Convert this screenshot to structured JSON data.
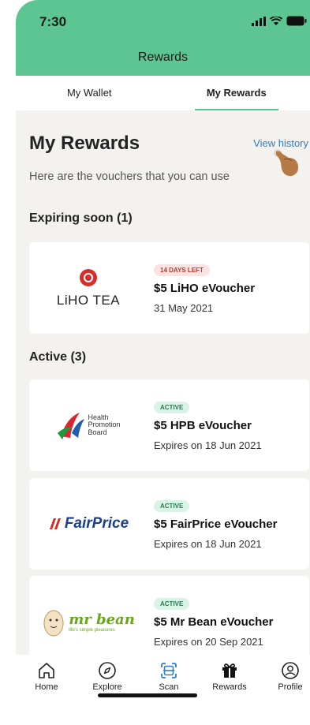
{
  "status": {
    "time": "7:30"
  },
  "header": {
    "title": "Rewards"
  },
  "tabs": [
    {
      "label": "My Wallet"
    },
    {
      "label": "My Rewards"
    }
  ],
  "page": {
    "title": "My Rewards",
    "view_history": "View history",
    "subtitle": "Here are the vouchers that you can use"
  },
  "expiring": {
    "title": "Expiring soon (1)",
    "items": [
      {
        "brand": "LiHO TEA",
        "badge": "14 DAYS LEFT",
        "name": "$5 LiHO eVoucher",
        "date": "31 May 2021"
      }
    ]
  },
  "active": {
    "title": "Active (3)",
    "items": [
      {
        "brand_line1": "Health",
        "brand_line2": "Promotion",
        "brand_line3": "Board",
        "badge": "ACTIVE",
        "name": "$5 HPB eVoucher",
        "date": "Expires on 18 Jun 2021"
      },
      {
        "brand": "FairPrice",
        "badge": "ACTIVE",
        "name": "$5 FairPrice eVoucher",
        "date": "Expires on 18 Jun 2021"
      },
      {
        "brand": "mr bean",
        "tagline": "life's simple pleasures",
        "badge": "ACTIVE",
        "name": "$5 Mr Bean eVoucher",
        "date": "Expires on 20 Sep 2021"
      }
    ]
  },
  "nav": [
    {
      "label": "Home",
      "icon": "home-icon"
    },
    {
      "label": "Explore",
      "icon": "compass-icon"
    },
    {
      "label": "Scan",
      "icon": "scan-icon"
    },
    {
      "label": "Rewards",
      "icon": "gift-icon"
    },
    {
      "label": "Profile",
      "icon": "profile-icon"
    }
  ],
  "colors": {
    "brand_green": "#5cc591",
    "link_blue": "#2f7fcb",
    "scan_blue": "#2f7fcb"
  }
}
